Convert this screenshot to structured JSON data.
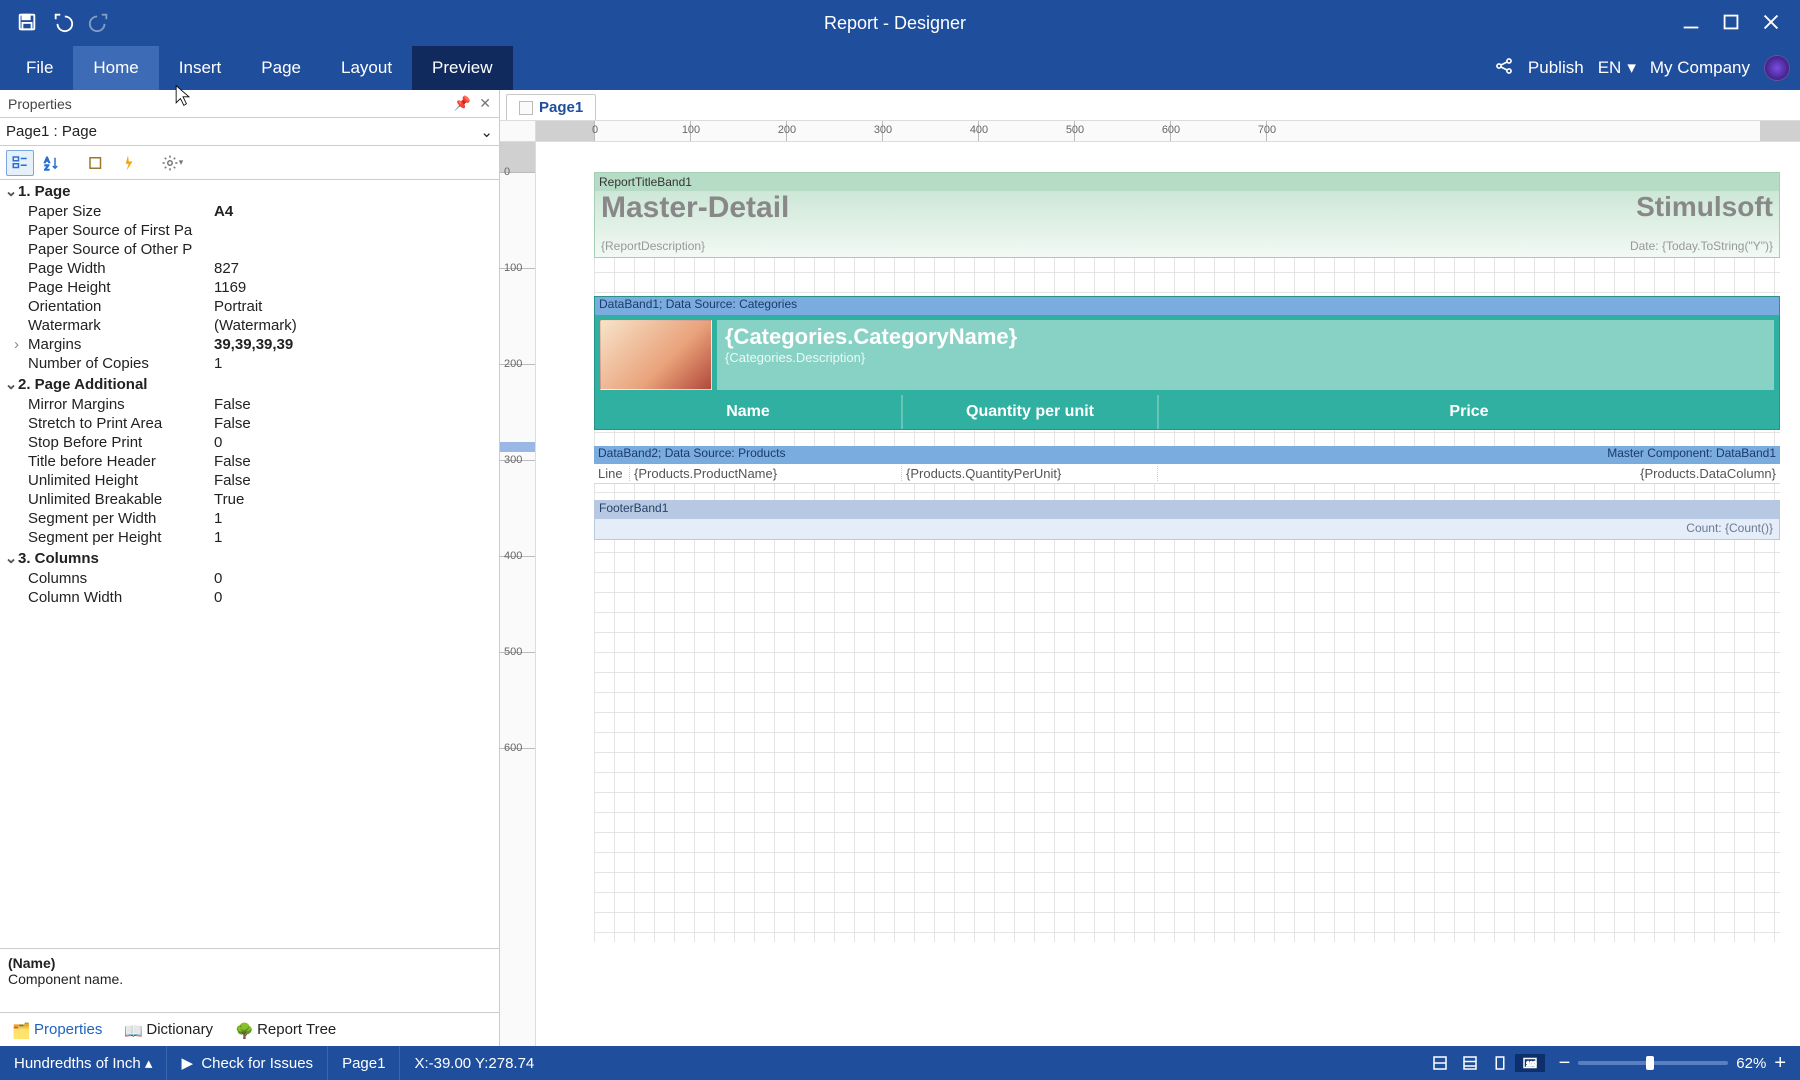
{
  "titlebar": {
    "title": "Report - Designer"
  },
  "menu": {
    "tabs": [
      "File",
      "Home",
      "Insert",
      "Page",
      "Layout",
      "Preview"
    ],
    "active": "Home",
    "publish": "Publish",
    "lang": "EN",
    "company": "My Company"
  },
  "properties": {
    "header": "Properties",
    "selector": "Page1 : Page",
    "groups": [
      {
        "name": "1. Page",
        "rows": [
          {
            "k": "Paper Size",
            "v": "A4",
            "bold": true
          },
          {
            "k": "Paper Source of First Pa",
            "v": ""
          },
          {
            "k": "Paper Source of Other P",
            "v": ""
          },
          {
            "k": "Page Width",
            "v": "827"
          },
          {
            "k": "Page Height",
            "v": "1169"
          },
          {
            "k": "Orientation",
            "v": "Portrait"
          },
          {
            "k": "Watermark",
            "v": "(Watermark)"
          },
          {
            "k": "Margins",
            "v": "39,39,39,39",
            "expandable": true,
            "bold": true
          },
          {
            "k": "Number of Copies",
            "v": "1"
          }
        ]
      },
      {
        "name": "2. Page  Additional",
        "rows": [
          {
            "k": "Mirror Margins",
            "v": "False"
          },
          {
            "k": "Stretch to Print Area",
            "v": "False"
          },
          {
            "k": "Stop Before Print",
            "v": "0"
          },
          {
            "k": "Title before Header",
            "v": "False"
          },
          {
            "k": "Unlimited Height",
            "v": "False"
          },
          {
            "k": "Unlimited Breakable",
            "v": "True"
          },
          {
            "k": "Segment per Width",
            "v": "1"
          },
          {
            "k": "Segment per Height",
            "v": "1"
          }
        ]
      },
      {
        "name": "3. Columns",
        "rows": [
          {
            "k": "Columns",
            "v": "0"
          },
          {
            "k": "Column Width",
            "v": "0"
          }
        ]
      }
    ],
    "desc": {
      "name": "(Name)",
      "text": "Component name."
    },
    "tabs": [
      "Properties",
      "Dictionary",
      "Report Tree"
    ]
  },
  "designer": {
    "pageTab": "Page1",
    "hTicks": [
      "0",
      "100",
      "200",
      "300",
      "400",
      "500",
      "600",
      "700"
    ],
    "vTicks": [
      "0",
      "100",
      "200",
      "300",
      "400",
      "500",
      "600"
    ],
    "titleBand": {
      "label": "ReportTitleBand1",
      "big": "Master-Detail",
      "brand": "Stimulsoft",
      "desc": "{ReportDescription}",
      "date": "Date: {Today.ToString(\"Y\")}"
    },
    "db1": {
      "head": "DataBand1; Data Source: Categories",
      "cat": "{Categories.CategoryName}",
      "catd": "{Categories.Description}",
      "cols": [
        "Name",
        "Quantity per unit",
        "Price"
      ]
    },
    "db2": {
      "headL": "DataBand2; Data Source: Products",
      "headR": "Master Component: DataBand1",
      "c0": "Line",
      "c1": "{Products.ProductName}",
      "c2": "{Products.QuantityPerUnit}",
      "c3": "{Products.DataColumn}"
    },
    "footer": {
      "head": "FooterBand1",
      "body": "Count: {Count()}"
    }
  },
  "status": {
    "units": "Hundredths of Inch",
    "check": "Check for Issues",
    "page": "Page1",
    "coord": "X:-39.00 Y:278.74",
    "zoom": "62%"
  }
}
